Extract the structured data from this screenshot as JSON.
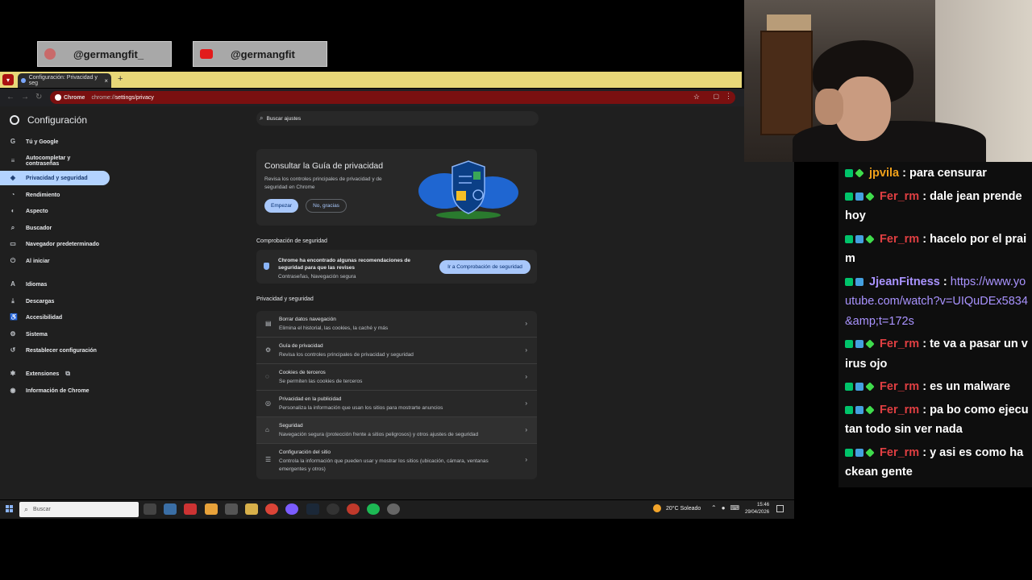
{
  "social": {
    "handle1": "@germangfit_",
    "handle2": "@germangfit"
  },
  "browser": {
    "tab_title": "Configuración: Privacidad y seg",
    "tab_close": "×",
    "new_tab": "+",
    "url_chip": "Chrome",
    "url_prefix": "chrome://",
    "url_path": "settings/privacy"
  },
  "settings": {
    "title": "Configuración",
    "search_placeholder": "Buscar ajustes",
    "nav": [
      {
        "label": "Tú y Google",
        "icon": "G"
      },
      {
        "label": "Autocompletar y contraseñas",
        "icon": "≡"
      },
      {
        "label": "Privacidad y seguridad",
        "icon": "◈"
      },
      {
        "label": "Rendimiento",
        "icon": "◔"
      },
      {
        "label": "Aspecto",
        "icon": "◐"
      },
      {
        "label": "Buscador",
        "icon": "⌕"
      },
      {
        "label": "Navegador predeterminado",
        "icon": "▭"
      },
      {
        "label": "Al iniciar",
        "icon": "⏻"
      },
      {
        "label": "Idiomas",
        "icon": "A"
      },
      {
        "label": "Descargas",
        "icon": "⤓"
      },
      {
        "label": "Accesibilidad",
        "icon": "♿"
      },
      {
        "label": "Sistema",
        "icon": "⚙"
      },
      {
        "label": "Restablecer configuración",
        "icon": "↺"
      },
      {
        "label": "Extensiones",
        "icon": "✱"
      },
      {
        "label": "Información de Chrome",
        "icon": "◉"
      }
    ],
    "guide": {
      "title": "Consultar la Guía de privacidad",
      "desc": "Revisa los controles principales de privacidad y de seguridad en Chrome",
      "start": "Empezar",
      "no": "No, gracias"
    },
    "check_section": "Comprobación de seguridad",
    "check": {
      "text": "Chrome ha encontrado algunas recomendaciones de seguridad para que las revises",
      "sub": "Contraseñas, Navegación segura",
      "button": "Ir a Comprobación de seguridad"
    },
    "privacy_section": "Privacidad y seguridad",
    "rows": [
      {
        "title": "Borrar datos navegación",
        "sub": "Elimina el historial, las cookies, la caché y más",
        "icon": "🗑"
      },
      {
        "title": "Guía de privacidad",
        "sub": "Revisa los controles principales de privacidad y seguridad",
        "icon": "⚙"
      },
      {
        "title": "Cookies de terceros",
        "sub": "Se permiten las cookies de terceros",
        "icon": "◌"
      },
      {
        "title": "Privacidad en la publicidad",
        "sub": "Personaliza la información que usan los sitios para mostrarte anuncios",
        "icon": "◎"
      },
      {
        "title": "Seguridad",
        "sub": "Navegación segura (protección frente a sitios peligrosos) y otros ajustes de seguridad",
        "icon": "🔒"
      },
      {
        "title": "Configuración del sitio",
        "sub": "Controla la información que pueden usar y mostrar los sitios (ubicación, cámara, ventanas emergentes y otros)",
        "icon": "☰"
      }
    ]
  },
  "taskbar": {
    "search": "Buscar",
    "weather": "20°C  Soleado",
    "time": "15:46",
    "date": "29/04/2026"
  },
  "chat": [
    {
      "user": "jpvila",
      "text": " : para censurar",
      "color": "orange"
    },
    {
      "user": "Fer_rm",
      "text": " : dale jean prende hoy",
      "color": "red"
    },
    {
      "user": "Fer_rm",
      "text": " : hacelo por el praim",
      "color": "red"
    },
    {
      "user": "JjeanFitness",
      "text": " : ",
      "link": "https://www.youtube.com/watch?v=UIQuDEx5834&amp;t=172s",
      "color": "purple"
    },
    {
      "user": "Fer_rm",
      "text": " : te va a pasar un virus ojo",
      "color": "red"
    },
    {
      "user": "Fer_rm",
      "text": " : es un malware",
      "color": "red"
    },
    {
      "user": "Fer_rm",
      "text": " : pa bo como ejecutan todo sin ver nada",
      "color": "red"
    },
    {
      "user": "Fer_rm",
      "text": " : y asi es como hackean gente",
      "color": "red"
    }
  ]
}
